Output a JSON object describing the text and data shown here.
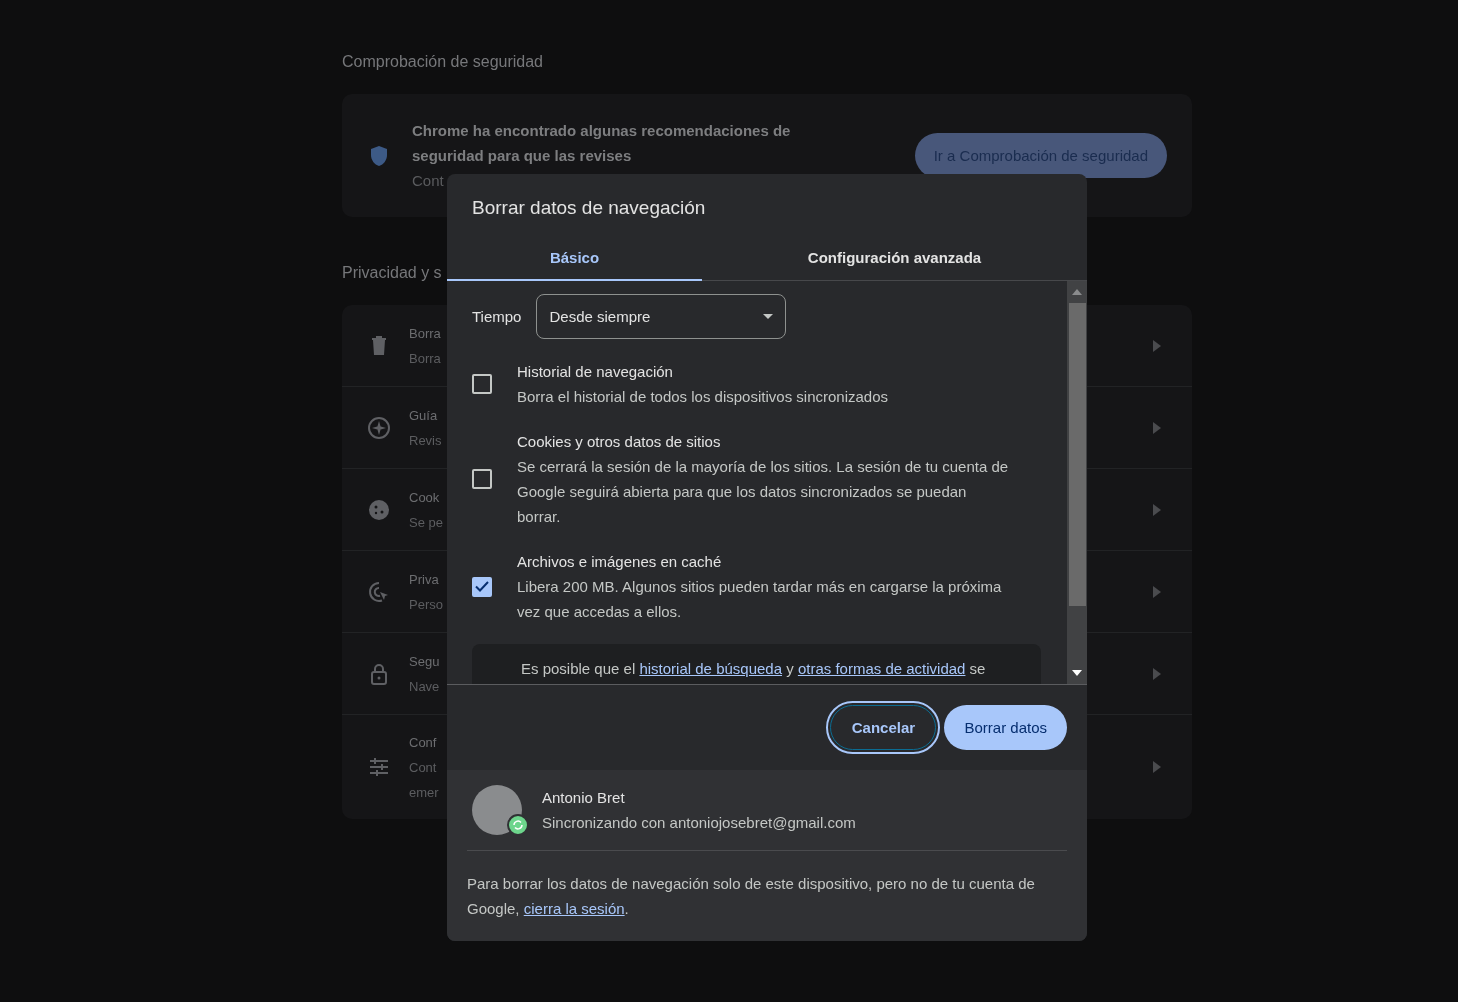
{
  "safety_check": {
    "heading": "Comprobación de seguridad",
    "message": "Chrome ha encontrado algunas recomendaciones de seguridad para que las revises",
    "detail": "Cont",
    "button": "Ir a Comprobación de seguridad"
  },
  "privacy": {
    "heading": "Privacidad y s",
    "rows": [
      {
        "lines": [
          "Borra",
          "Borra"
        ]
      },
      {
        "lines": [
          "Guía",
          "Revis"
        ]
      },
      {
        "lines": [
          "Cook",
          "Se pe"
        ]
      },
      {
        "lines": [
          "Priva",
          "Perso"
        ]
      },
      {
        "lines": [
          "Segu",
          "Nave"
        ]
      },
      {
        "lines": [
          "Conf",
          "Cont",
          "emer"
        ]
      }
    ]
  },
  "dialog": {
    "title": "Borrar datos de navegación",
    "tabs": [
      {
        "label": "Básico",
        "selected": true
      },
      {
        "label": "Configuración avanzada",
        "selected": false
      }
    ],
    "time": {
      "label": "Tiempo",
      "value": "Desde siempre"
    },
    "options": [
      {
        "title": "Historial de navegación",
        "description": "Borra el historial de todos los dispositivos sincronizados",
        "checked": false
      },
      {
        "title": "Cookies y otros datos de sitios",
        "description": "Se cerrará la sesión de la mayoría de los sitios. La sesión de tu cuenta de Google seguirá abierta para que los datos sincronizados se puedan borrar.",
        "checked": false
      },
      {
        "title": "Archivos e imágenes en caché",
        "description": "Libera 200 MB. Algunos sitios pueden tardar más en cargarse la próxima vez que accedas a ellos.",
        "checked": true
      }
    ],
    "notice": {
      "before": "Es posible que el ",
      "link_1": "historial de búsqueda",
      "middle": " y ",
      "link_2": "otras formas de actividad",
      "after": " se"
    },
    "buttons": [
      {
        "label": "Cancelar",
        "kind": "secondary",
        "focused": true
      },
      {
        "label": "Borrar datos",
        "kind": "primary",
        "focused": false
      }
    ],
    "account": {
      "name": "Antonio Bret",
      "status": "Sincronizando con antoniojosebret@gmail.com"
    },
    "footer_note": {
      "before": "Para borrar los datos de navegación solo de este dispositivo, pero no de tu cuenta de Google, ",
      "link": "cierra la sesión",
      "after": "."
    }
  }
}
